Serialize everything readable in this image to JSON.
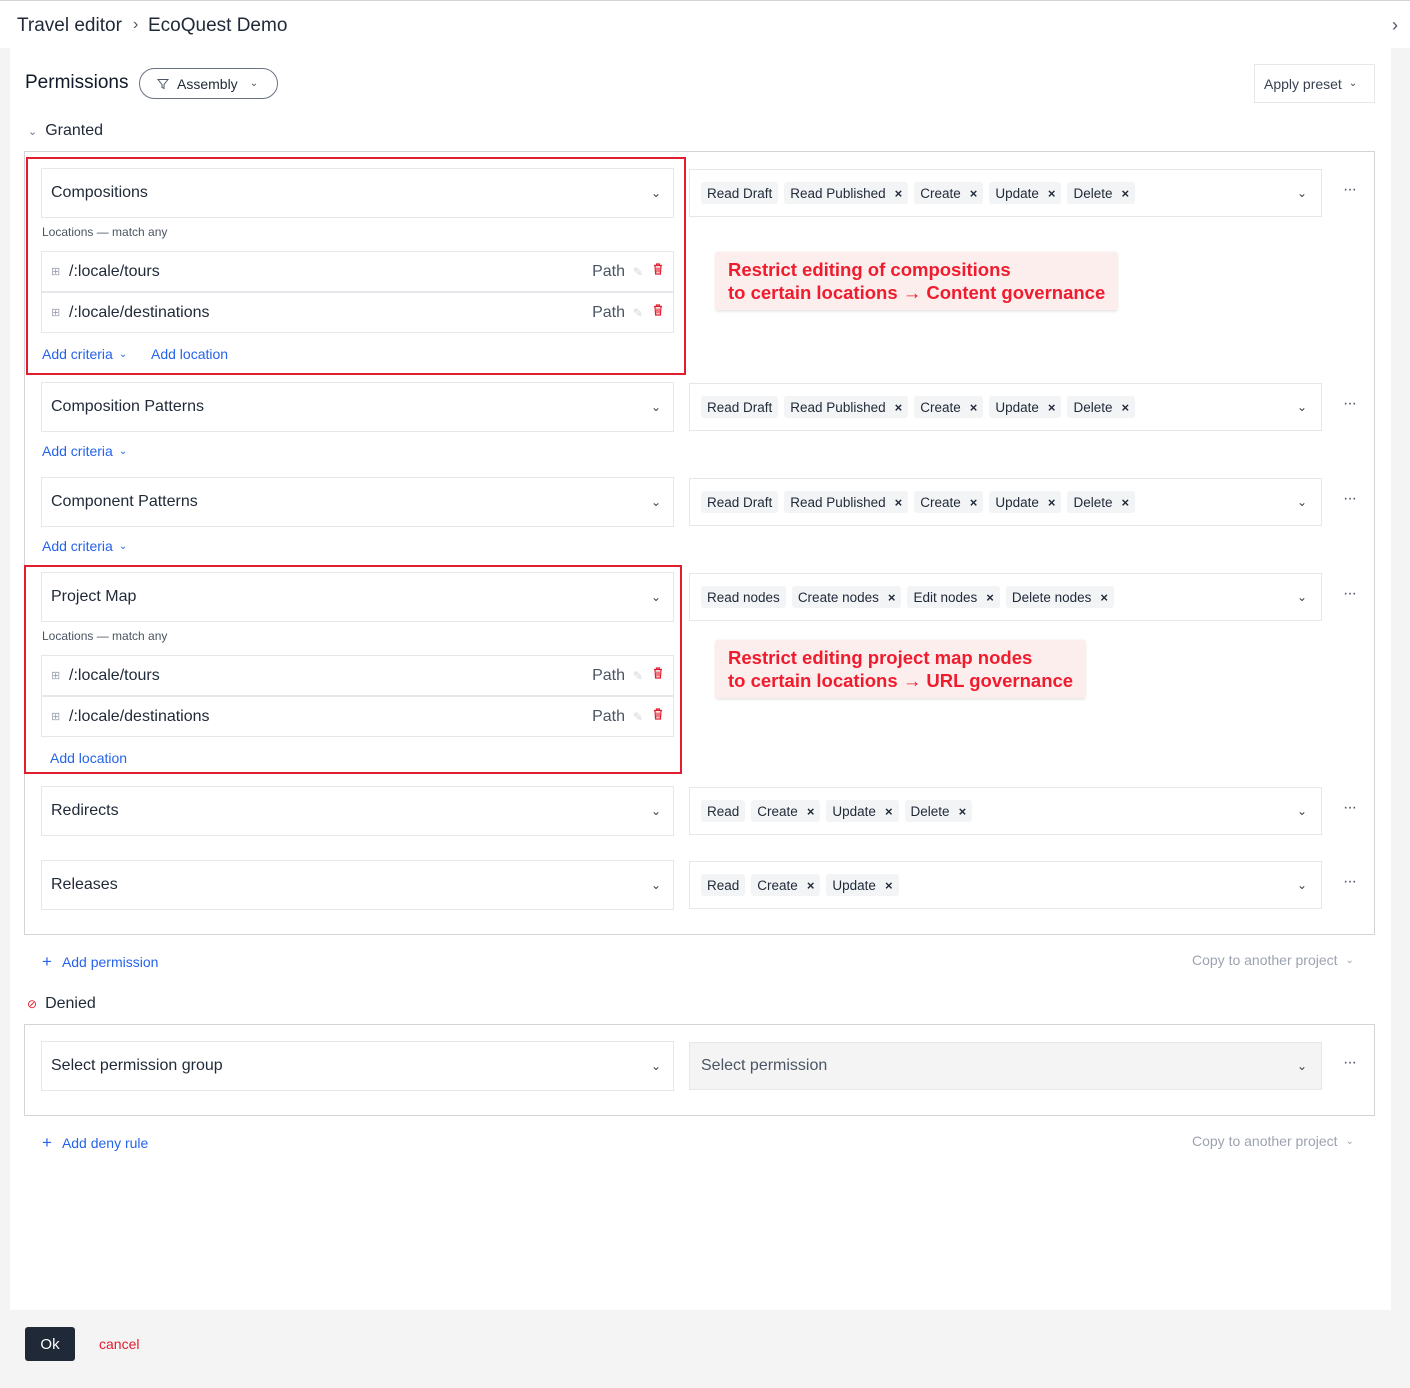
{
  "breadcrumb": {
    "parent": "Travel editor",
    "separator": "›",
    "current": "EcoQuest Demo"
  },
  "header": {
    "title": "Permissions",
    "filter_label": "Assembly",
    "apply_preset": "Apply preset"
  },
  "granted": {
    "label": "Granted",
    "rows": [
      {
        "group": "Compositions",
        "locations_caption": "Locations — match any",
        "locations": [
          {
            "path": "/:locale/tours",
            "type": "Path"
          },
          {
            "path": "/:locale/destinations",
            "type": "Path"
          }
        ],
        "add_criteria": "Add criteria",
        "add_location": "Add location",
        "permissions": [
          "Read Draft",
          "Read Published",
          "Create",
          "Update",
          "Delete"
        ]
      },
      {
        "group": "Composition Patterns",
        "add_criteria": "Add criteria",
        "permissions": [
          "Read Draft",
          "Read Published",
          "Create",
          "Update",
          "Delete"
        ]
      },
      {
        "group": "Component Patterns",
        "add_criteria": "Add criteria",
        "permissions": [
          "Read Draft",
          "Read Published",
          "Create",
          "Update",
          "Delete"
        ]
      },
      {
        "group": "Project Map",
        "locations_caption": "Locations — match any",
        "locations": [
          {
            "path": "/:locale/tours",
            "type": "Path"
          },
          {
            "path": "/:locale/destinations",
            "type": "Path"
          }
        ],
        "add_location": "Add location",
        "permissions": [
          "Read nodes",
          "Create nodes",
          "Edit nodes",
          "Delete nodes"
        ]
      },
      {
        "group": "Redirects",
        "permissions": [
          "Read",
          "Create",
          "Update",
          "Delete"
        ]
      },
      {
        "group": "Releases",
        "permissions": [
          "Read",
          "Create",
          "Update"
        ]
      }
    ],
    "add_permission": "Add permission",
    "copy_to_project": "Copy to another project"
  },
  "callouts": [
    {
      "line1": "Restrict editing of compositions",
      "line2": "to certain locations → Content governance"
    },
    {
      "line1": "Restrict editing project map nodes",
      "line2": "to certain locations → URL governance"
    }
  ],
  "denied": {
    "label": "Denied",
    "group_placeholder": "Select permission group",
    "permission_placeholder": "Select permission",
    "add_deny_rule": "Add deny rule",
    "copy_to_project": "Copy to another project"
  },
  "footer": {
    "ok": "Ok",
    "cancel": "cancel"
  },
  "colors": {
    "accent_link": "#2563eb",
    "annotation_red": "#e11d2e",
    "primary_button": "#1f2937"
  }
}
